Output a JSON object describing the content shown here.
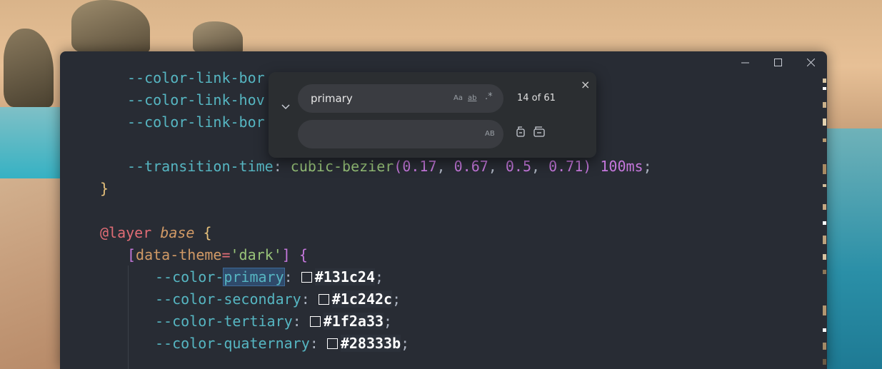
{
  "window": {
    "controls": {
      "minimize": "minimize",
      "maximize": "maximize",
      "close": "close"
    }
  },
  "code": {
    "l1_prop": "--color-link-bor",
    "l2_prop": "--color-link-hov",
    "l3_prop": "--color-link-bor",
    "l5_prop": "--transition-time",
    "l5_colon": ": ",
    "l5_fn": "cubic-bezier",
    "l5_open": "(",
    "l5_a": "0.17",
    "l5_b": "0.67",
    "l5_c": "0.5",
    "l5_d": "0.71",
    "l5_close": ")",
    "l5_time": "100ms",
    "l5_semi": ";",
    "l6_brace": "}",
    "l8_at": "@layer",
    "l8_name": "base",
    "l8_brace": "{",
    "l9_open": "[",
    "l9_attr": "data-theme",
    "l9_eq": "=",
    "l9_val": "'dark'",
    "l9_close": "]",
    "l9_brace": "{",
    "l10_pre": "--color-",
    "l10_match": "primary",
    "l10_colon": ": ",
    "l10_hex": "#131c24",
    "l11_prop": "--color-secondary",
    "l11_colon": ": ",
    "l11_hex": "#1c242c",
    "l12_prop": "--color-tertiary",
    "l12_colon": ": ",
    "l12_hex": "#1f2a33",
    "l13_prop": "--color-quaternary",
    "l13_colon": ": ",
    "l13_hex": "#28333b",
    "semi": ";",
    "comma": ", "
  },
  "find": {
    "search_value": "primary",
    "replace_value": "",
    "match_case": "Aa",
    "whole_word": "ab",
    "regex": ".*",
    "preserve_case": "AB",
    "count": "14 of 61",
    "close": "×"
  },
  "colors": {
    "editor_bg": "#282c34",
    "property": "#56b6c2",
    "function": "#98c379",
    "number": "#c678dd",
    "brace": "#e5c07b"
  }
}
